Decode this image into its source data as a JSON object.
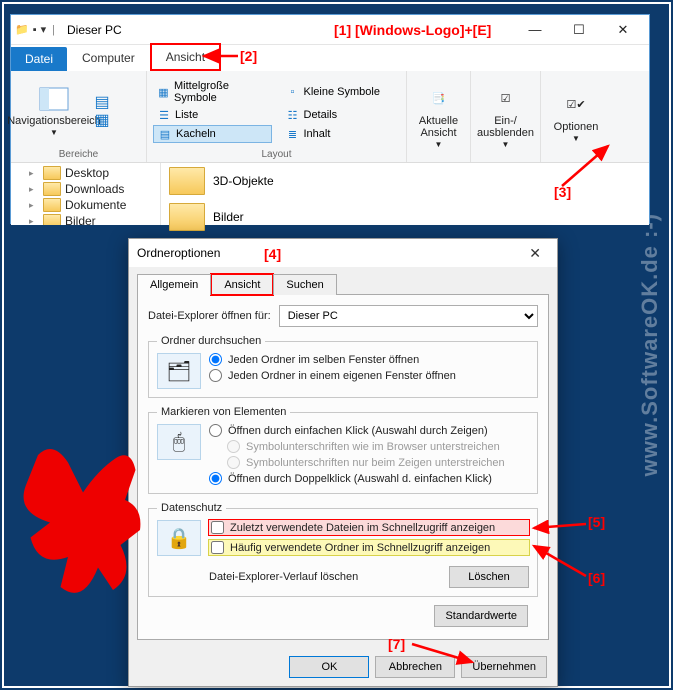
{
  "annotations": {
    "a1": "[1]  [Windows-Logo]+[E]",
    "a2": "[2]",
    "a3": "[3]",
    "a4": "[4]",
    "a5": "[5]",
    "a6": "[6]",
    "a7": "[7]"
  },
  "watermark": "www.SoftwareOK.de :-)",
  "explorer": {
    "title": "Dieser PC",
    "tabs": {
      "file": "Datei",
      "computer": "Computer",
      "view": "Ansicht"
    },
    "ribbon": {
      "nav_label": "Navigationsbereich",
      "group_panes": "Bereiche",
      "layout": {
        "medium": "Mittelgroße Symbole",
        "small": "Kleine Symbole",
        "list": "Liste",
        "details": "Details",
        "tiles": "Kacheln",
        "content": "Inhalt",
        "group_label": "Layout"
      },
      "current_view": "Aktuelle Ansicht",
      "show_hide": "Ein-/ ausblenden",
      "options": "Optionen"
    },
    "tree": {
      "desktop": "Desktop",
      "downloads": "Downloads",
      "documents": "Dokumente",
      "pictures": "Bilder"
    },
    "files": {
      "objects3d": "3D-Objekte",
      "pictures": "Bilder"
    }
  },
  "dialog": {
    "title": "Ordneroptionen",
    "tabs": {
      "general": "Allgemein",
      "view": "Ansicht",
      "search": "Suchen"
    },
    "open_for_label": "Datei-Explorer öffnen für:",
    "open_for_value": "Dieser PC",
    "browse": {
      "legend": "Ordner durchsuchen",
      "same": "Jeden Ordner im selben Fenster öffnen",
      "own": "Jeden Ordner in einem eigenen Fenster öffnen"
    },
    "click": {
      "legend": "Markieren von Elementen",
      "single": "Öffnen durch einfachen Klick (Auswahl durch Zeigen)",
      "browser": "Symbolunterschriften wie im Browser unterstreichen",
      "hover": "Symbolunterschriften nur beim Zeigen unterstreichen",
      "double": "Öffnen durch Doppelklick (Auswahl d. einfachen Klick)"
    },
    "privacy": {
      "legend": "Datenschutz",
      "recent": "Zuletzt verwendete Dateien im Schnellzugriff anzeigen",
      "frequent": "Häufig verwendete Ordner im Schnellzugriff anzeigen",
      "clear_label": "Datei-Explorer-Verlauf löschen",
      "clear_btn": "Löschen"
    },
    "defaults_btn": "Standardwerte",
    "ok": "OK",
    "cancel": "Abbrechen",
    "apply": "Übernehmen"
  }
}
